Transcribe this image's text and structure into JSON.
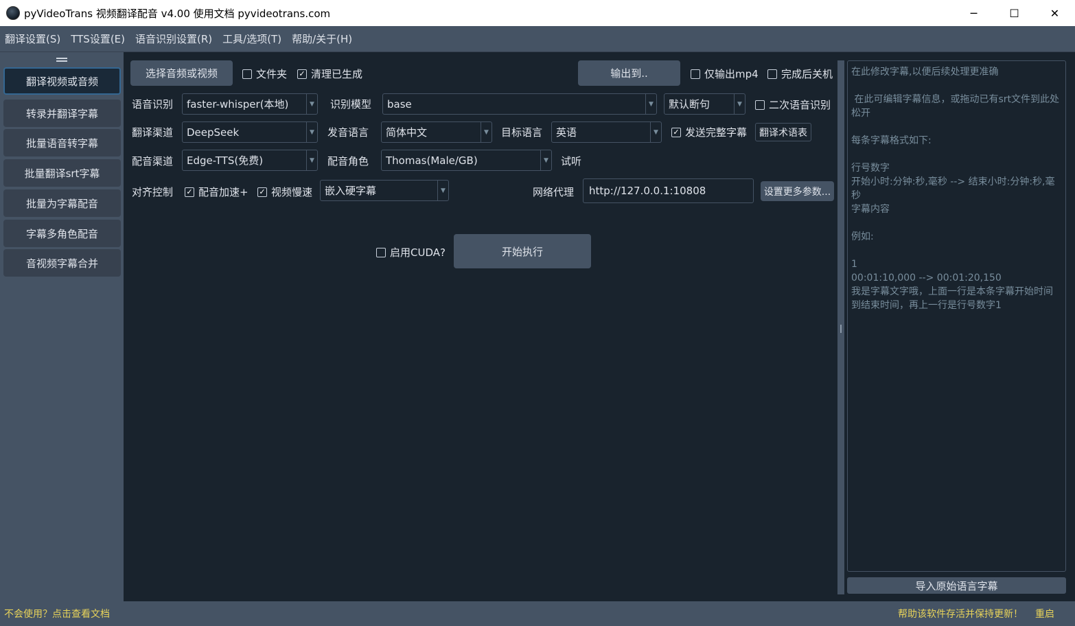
{
  "window": {
    "title": "pyVideoTrans 视频翻译配音 v4.00 使用文档 pyvideotrans.com",
    "minimize": "─",
    "maximize": "☐",
    "close": "✕"
  },
  "menu": [
    "翻译设置(S)",
    "TTS设置(E)",
    "语音识别设置(R)",
    "工具/选项(T)",
    "帮助/关于(H)"
  ],
  "sidebar": {
    "items": [
      {
        "label": "翻译视频或音频",
        "active": true
      },
      {
        "label": "转录并翻译字幕"
      },
      {
        "label": "批量语音转字幕"
      },
      {
        "label": "批量翻译srt字幕"
      },
      {
        "label": "批量为字幕配音"
      },
      {
        "label": "字幕多角色配音"
      },
      {
        "label": "音视频字幕合并"
      }
    ]
  },
  "toolbar": {
    "select_media": "选择音频或视频",
    "folder": {
      "label": "文件夹",
      "checked": false
    },
    "clean_generated": {
      "label": "清理已生成",
      "checked": true
    },
    "output_to": "输出到..",
    "only_mp4": {
      "label": "仅输出mp4",
      "checked": false
    },
    "shutdown_after": {
      "label": "完成后关机",
      "checked": false
    }
  },
  "row_asr": {
    "label": "语音识别",
    "engine": "faster-whisper(本地)",
    "model_label": "识别模型",
    "model": "base",
    "split_mode": "默认断句",
    "second_asr": {
      "label": "二次语音识别",
      "checked": false
    }
  },
  "row_translate": {
    "label": "翻译渠道",
    "channel": "DeepSeek",
    "source_label": "发音语言",
    "source_lang": "简体中文",
    "target_label": "目标语言",
    "target_lang": "英语",
    "send_full": {
      "label": "发送完整字幕",
      "checked": true
    },
    "glossary": "翻译术语表"
  },
  "row_tts": {
    "label": "配音渠道",
    "channel": "Edge-TTS(免费)",
    "role_label": "配音角色",
    "role": "Thomas(Male/GB)",
    "listen": "试听"
  },
  "row_align": {
    "label": "对齐控制",
    "speed_up": {
      "label": "配音加速+",
      "checked": true
    },
    "video_slow": {
      "label": "视频慢速",
      "checked": true
    },
    "subtitle_mode": "嵌入硬字幕",
    "proxy_label": "网络代理",
    "proxy_value": "http://127.0.0.1:10808",
    "more_params": "设置更多参数..."
  },
  "run": {
    "cuda": {
      "label": "启用CUDA?",
      "checked": false
    },
    "start": "开始执行"
  },
  "subtitle_panel": {
    "text": "在此修改字幕,以便后续处理更准确\n\n 在此可编辑字幕信息，或拖动已有srt文件到此处松开\n\n每条字幕格式如下:\n\n行号数字\n开始小时:分钟:秒,毫秒 --> 结束小时:分钟:秒,毫秒\n字幕内容\n\n例如:\n\n1\n00:01:10,000 --> 00:01:20,150\n我是字幕文字哦，上面一行是本条字幕开始时间到结束时间，再上一行是行号数字1",
    "import_button": "导入原始语言字幕"
  },
  "statusbar": {
    "help_link": "不会使用？点击查看文档",
    "support": "帮助该软件存活并保持更新！",
    "restart": "重启"
  }
}
